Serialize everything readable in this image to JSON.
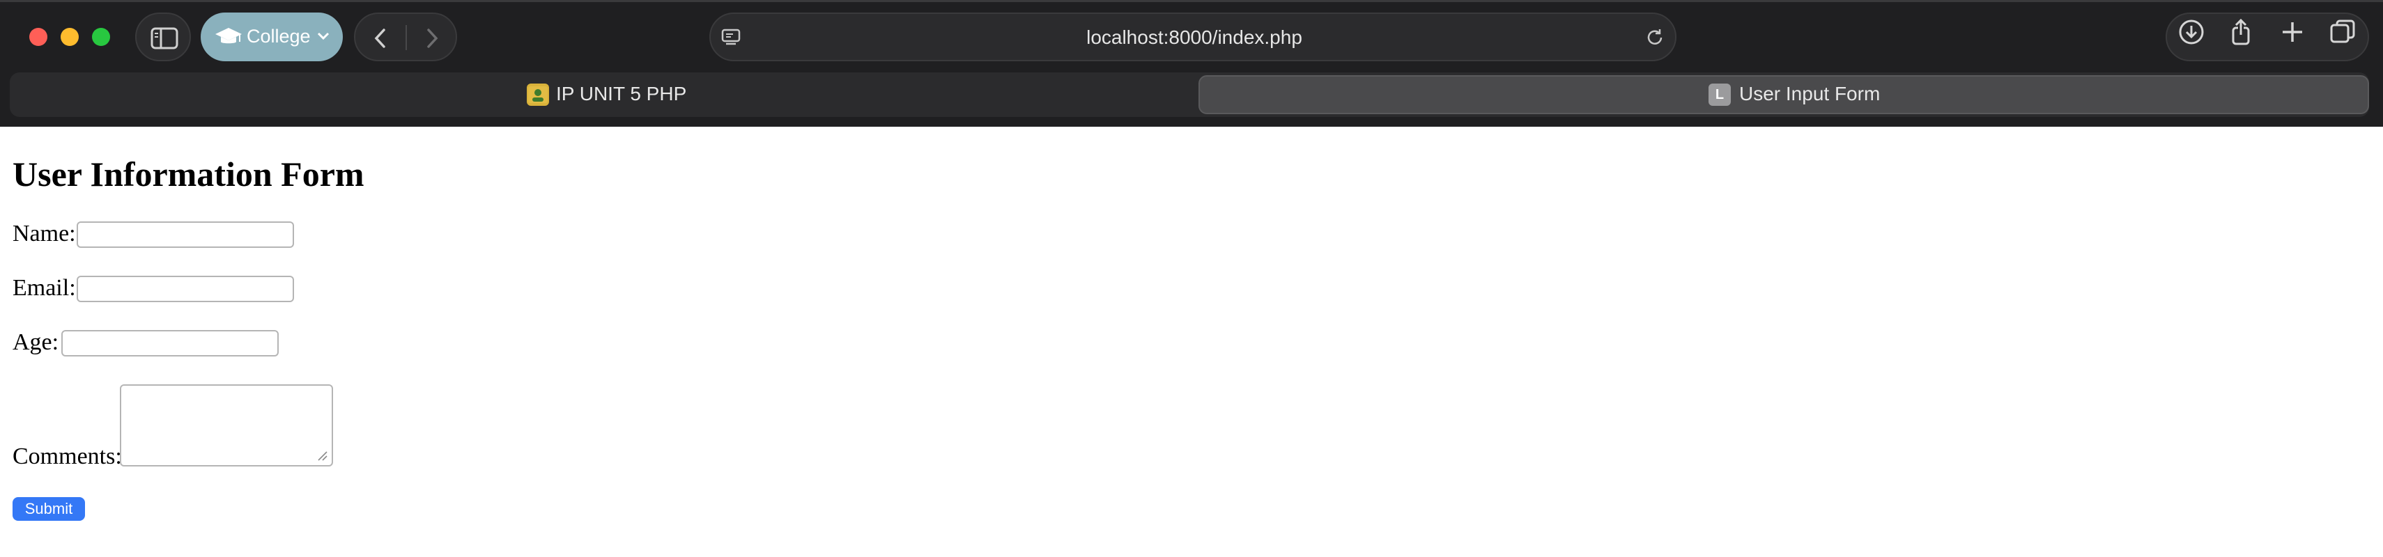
{
  "browser": {
    "profile_label": "College",
    "url": "localhost:8000/index.php",
    "tabs": [
      {
        "title": "IP UNIT 5 PHP",
        "active": false
      },
      {
        "title": "User Input Form",
        "active": true,
        "favicon_letter": "L"
      }
    ],
    "icons": [
      "sidebar-icon",
      "graduation-cap-icon",
      "chevron-down-icon",
      "back-arrow-icon",
      "forward-arrow-icon",
      "page-menu-icon",
      "reload-icon",
      "download-icon",
      "share-icon",
      "plus-icon",
      "tab-overview-icon"
    ],
    "colors": {
      "chrome_bg": "#1f1f21",
      "profile_accent": "#8ab1bd",
      "close": "#ff5f57",
      "minimize": "#febc2e",
      "maximize": "#28c840"
    }
  },
  "page": {
    "heading": "User Information Form",
    "fields": {
      "name": {
        "label": "Name:",
        "value": ""
      },
      "email": {
        "label": "Email:",
        "value": ""
      },
      "age": {
        "label": "Age:",
        "value": ""
      },
      "comments": {
        "label": "Comments:",
        "value": ""
      }
    },
    "submit_label": "Submit",
    "colors": {
      "submit_bg": "#3478f6"
    }
  }
}
